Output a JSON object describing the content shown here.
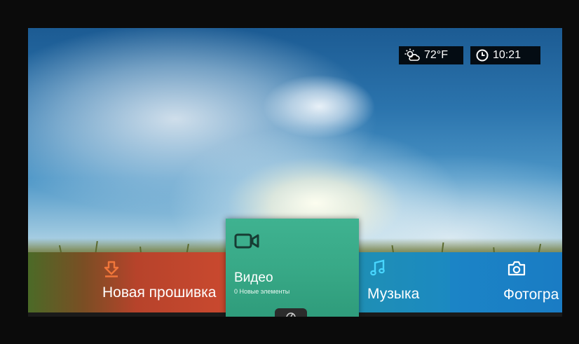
{
  "status": {
    "temperature": "72°F",
    "time": "10:21",
    "weather_icon": "partly-cloudy-icon",
    "clock_icon": "clock-icon"
  },
  "menu": {
    "firmware": {
      "label": "Новая прошивка",
      "icon": "download-icon",
      "color": "#e8672f"
    },
    "video": {
      "label": "Видео",
      "subtitle": "0 Новые элементы",
      "icon": "video-camera-icon"
    },
    "music": {
      "label": "Музыка",
      "icon": "music-note-icon",
      "color": "#3fd0ff"
    },
    "photos": {
      "label": "Фотогра",
      "icon": "camera-icon",
      "color": "#3fb9ff"
    }
  }
}
